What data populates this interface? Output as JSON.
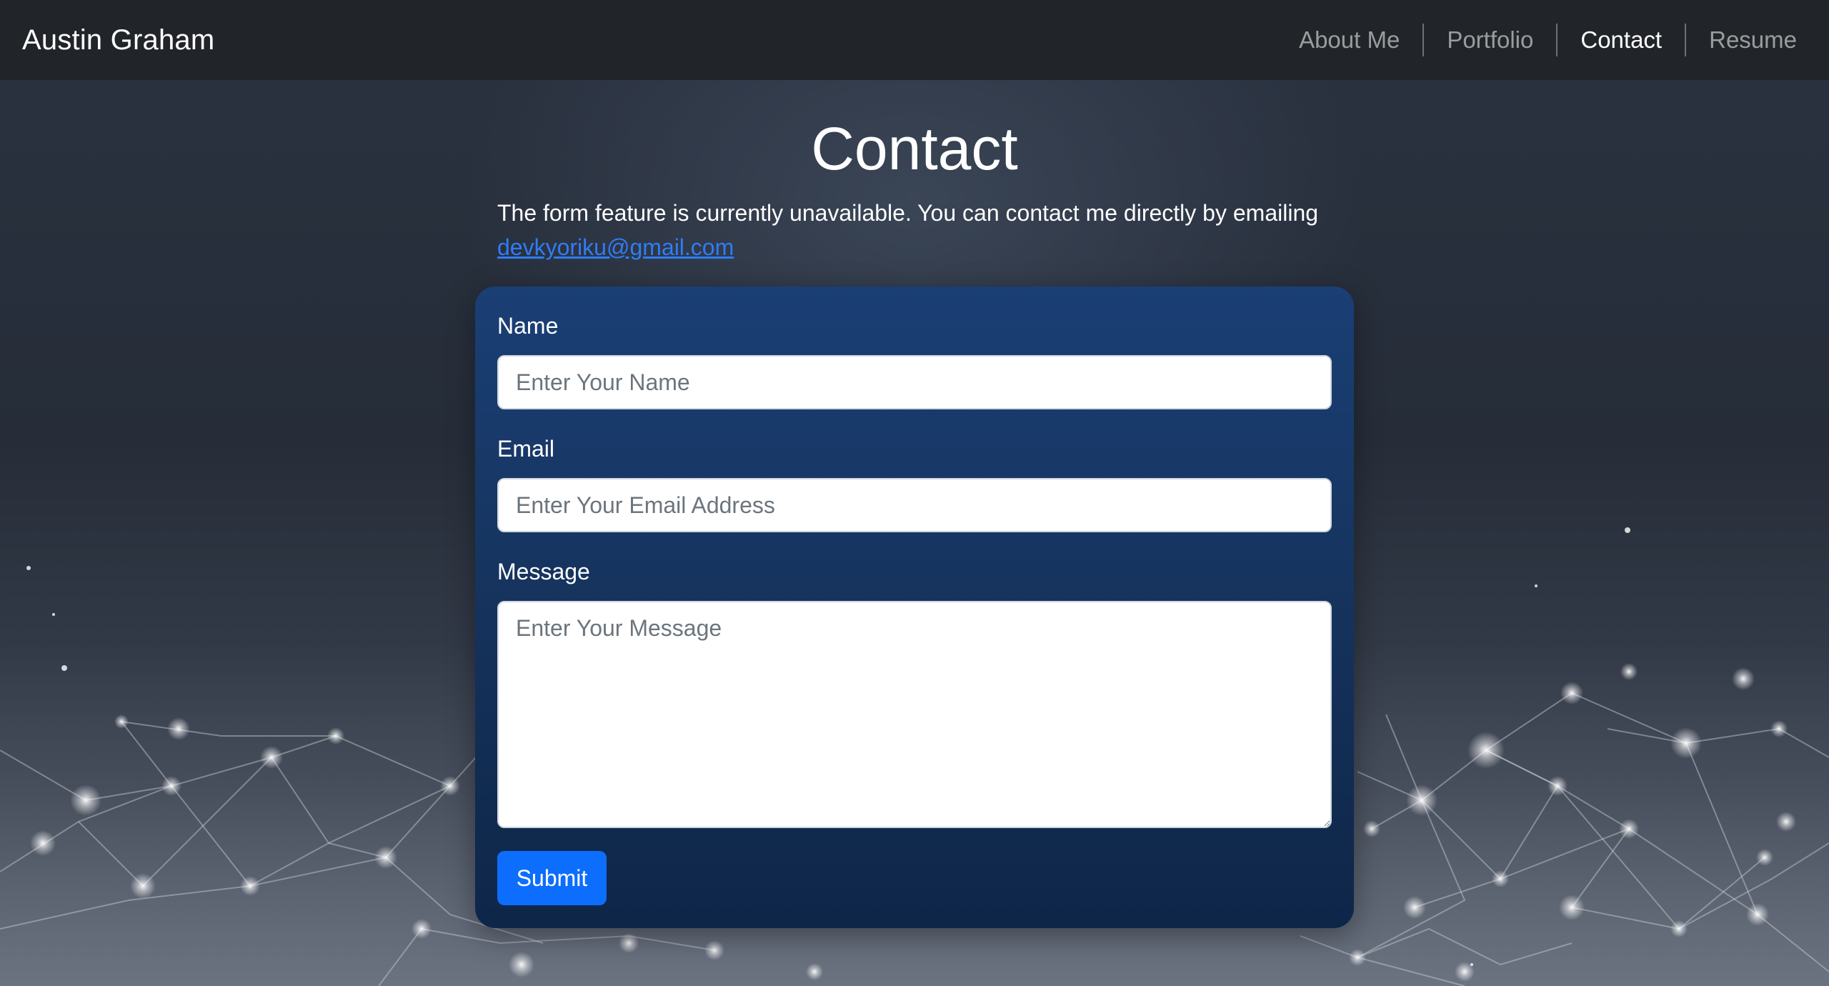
{
  "navbar": {
    "brand": "Austin Graham",
    "links": [
      {
        "label": "About Me",
        "active": false
      },
      {
        "label": "Portfolio",
        "active": false
      },
      {
        "label": "Contact",
        "active": true
      },
      {
        "label": "Resume",
        "active": false
      }
    ]
  },
  "page": {
    "title": "Contact",
    "notice_text": "The form feature is currently unavailable. You can contact me directly by emailing",
    "email": "devkyoriku@gmail.com"
  },
  "form": {
    "name": {
      "label": "Name",
      "placeholder": "Enter Your Name",
      "value": ""
    },
    "email": {
      "label": "Email",
      "placeholder": "Enter Your Email Address",
      "value": ""
    },
    "message": {
      "label": "Message",
      "placeholder": "Enter Your Message",
      "value": ""
    },
    "submit_label": "Submit"
  },
  "colors": {
    "navbar_bg": "#212529",
    "card_top": "#1a3f75",
    "card_bottom": "#0e2648",
    "primary_button": "#0d6efd",
    "link": "#2f7cf7"
  }
}
